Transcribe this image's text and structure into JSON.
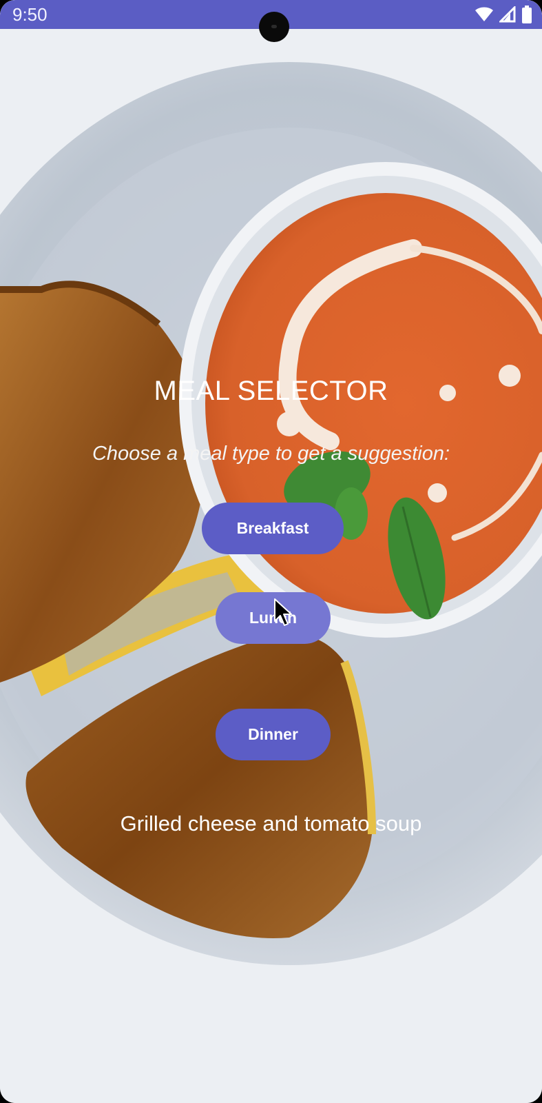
{
  "status_bar": {
    "time": "9:50",
    "icons": [
      "wifi-icon",
      "cellular-signal-icon",
      "battery-icon"
    ],
    "color": "#5b5dc4"
  },
  "background": {
    "description_icon": "grilled-cheese-tomato-soup-photo"
  },
  "app": {
    "title": "MEAL SELECTOR",
    "subtitle": "Choose a meal type to get a suggestion:",
    "buttons": {
      "breakfast": "Breakfast",
      "lunch": "Lunch",
      "dinner": "Dinner"
    },
    "suggestion": "Grilled cheese and tomato soup",
    "accent_color": "#5c5dc6",
    "pressed_color": "#7677d2"
  }
}
